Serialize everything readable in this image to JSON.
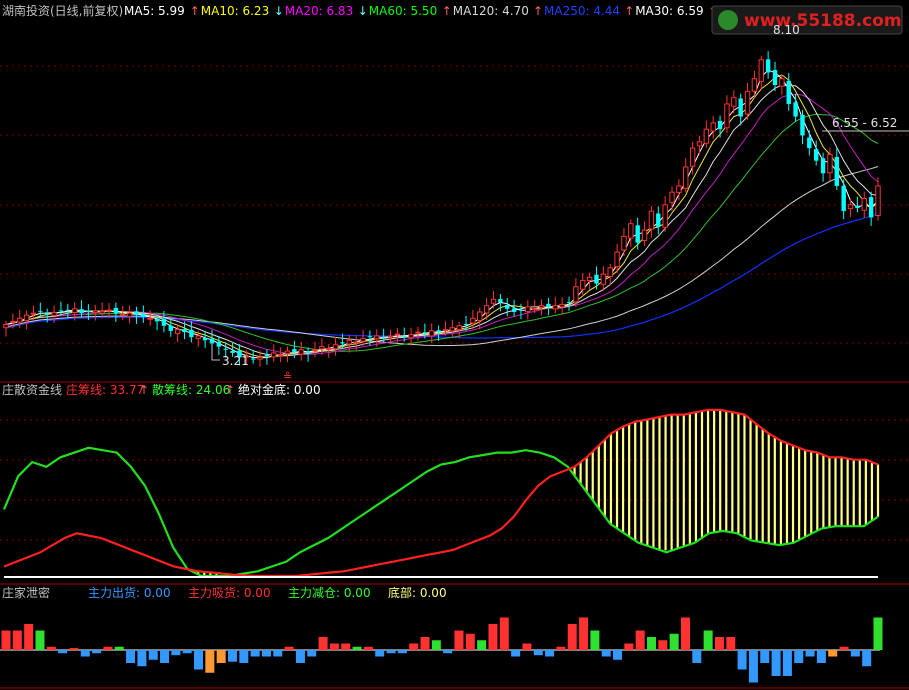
{
  "header": {
    "security_title": "湖南投资(日线,前复权)",
    "indicators": [
      {
        "label": "MA5: 5.99",
        "color": "#ffffff",
        "arrow": "up"
      },
      {
        "label": "MA10: 6.23",
        "color": "#ffff00",
        "arrow": "down"
      },
      {
        "label": "MA20: 6.83",
        "color": "#ff00ff",
        "arrow": "down"
      },
      {
        "label": "MA60: 5.50",
        "color": "#00ff00",
        "arrow": "up"
      },
      {
        "label": "MA120: 4.70",
        "color": "#d8d8d8",
        "arrow": "up"
      },
      {
        "label": "MA250: 4.44",
        "color": "#2040ff",
        "arrow": "up"
      },
      {
        "label": "MA30: 6.59",
        "color": "#ffffff",
        "arrow": "up"
      },
      {
        "label": "MA3: 6.00",
        "color": "#ffffff",
        "arrow": "up"
      }
    ]
  },
  "watermark": "www.55188.com",
  "price_panel": {
    "high_label": "8.10",
    "low_label": "3.21",
    "range_label": "6.55 - 6.52"
  },
  "fund_panel": {
    "title": "庄散资金线",
    "items": [
      {
        "label": "庄筹线: 33.77",
        "color": "#ff3030",
        "arrow": "up"
      },
      {
        "label": "散筹线: 24.06",
        "color": "#30ff30",
        "arrow": "up"
      },
      {
        "label": "绝对金底: 0.00",
        "color": "#ffffff",
        "arrow": ""
      }
    ]
  },
  "secret_panel": {
    "title": "庄家泄密",
    "items": [
      {
        "label": "主力出货: 0.00",
        "color": "#3399ff"
      },
      {
        "label": "主力吸货: 0.00",
        "color": "#ff3030"
      },
      {
        "label": "主力减仓: 0.00",
        "color": "#30ff30"
      },
      {
        "label": "底部: 0.00",
        "color": "#ffff80"
      }
    ]
  },
  "colors": {
    "up": "#ff3232",
    "down": "#00ffff",
    "grid": "#800000",
    "hatch": "#ffff80",
    "zhuang": "#ff2020",
    "san": "#20e020",
    "chu": "#3399ff",
    "jian": "#30e030",
    "di": "#ff9933"
  },
  "chart_data": {
    "type": "candlestick",
    "price_range": [
      3.0,
      8.6
    ],
    "close": [
      3.8,
      3.85,
      3.9,
      3.95,
      3.98,
      4.0,
      3.97,
      3.99,
      4.02,
      4.03,
      4.05,
      3.98,
      4.0,
      4.02,
      4.01,
      4.03,
      3.98,
      3.96,
      3.98,
      3.95,
      3.92,
      3.9,
      3.85,
      3.78,
      3.7,
      3.72,
      3.68,
      3.6,
      3.62,
      3.55,
      3.5,
      3.45,
      3.4,
      3.35,
      3.28,
      3.3,
      3.25,
      3.28,
      3.3,
      3.35,
      3.32,
      3.38,
      3.36,
      3.4,
      3.35,
      3.4,
      3.45,
      3.42,
      3.48,
      3.5,
      3.55,
      3.52,
      3.58,
      3.6,
      3.62,
      3.58,
      3.62,
      3.65,
      3.6,
      3.64,
      3.68,
      3.66,
      3.7,
      3.68,
      3.72,
      3.75,
      3.78,
      3.8,
      3.9,
      4.0,
      4.1,
      4.2,
      4.15,
      4.05,
      4.0,
      4.02,
      4.08,
      4.05,
      4.1,
      4.08,
      4.1,
      4.12,
      4.15,
      4.4,
      4.5,
      4.55,
      4.45,
      4.6,
      4.7,
      4.95,
      5.2,
      5.4,
      5.1,
      5.3,
      5.6,
      5.35,
      5.7,
      5.9,
      6.0,
      6.3,
      6.6,
      6.7,
      6.9,
      7.0,
      6.9,
      7.3,
      7.4,
      7.1,
      7.5,
      7.7,
      8.0,
      7.8,
      7.6,
      7.7,
      7.3,
      7.1,
      6.8,
      6.6,
      6.4,
      6.2,
      6.5,
      6.0,
      5.6,
      5.7,
      5.65,
      5.8,
      5.5,
      6.0
    ],
    "fund_zhuang": [
      4,
      6,
      8,
      10,
      13,
      16,
      18,
      17,
      16,
      14,
      12,
      10,
      8,
      6,
      4,
      3,
      2,
      1.5,
      1,
      0.5,
      0.2,
      0,
      0,
      0,
      0,
      0.5,
      1,
      1.5,
      2,
      3,
      4,
      5,
      6,
      7,
      8,
      9,
      10,
      11,
      13,
      15,
      17,
      20,
      25,
      32,
      38,
      42,
      44,
      46,
      50,
      55,
      60,
      63,
      65,
      66,
      67,
      68,
      68,
      69,
      70,
      70,
      69,
      68,
      64,
      60,
      57,
      55,
      53,
      52,
      50,
      50,
      49,
      49,
      47
    ],
    "fund_san": [
      28,
      42,
      48,
      46,
      50,
      52,
      54,
      53,
      52,
      46,
      38,
      26,
      12,
      3,
      0,
      0,
      0,
      1,
      2,
      4,
      6,
      10,
      13,
      16,
      20,
      24,
      28,
      32,
      36,
      40,
      44,
      47,
      48,
      50,
      51,
      52,
      52,
      53,
      52,
      50,
      46,
      38,
      30,
      22,
      18,
      14,
      12,
      10,
      12,
      14,
      18,
      19,
      18,
      15,
      14,
      13,
      14,
      17,
      20,
      21,
      21,
      21,
      25
    ],
    "secret_bars": [
      3,
      3,
      4,
      3,
      0.5,
      -0.5,
      0.3,
      -1,
      -0.5,
      0.5,
      0.5,
      -2,
      -2.5,
      -1.5,
      -2,
      -0.8,
      -0.5,
      -3,
      -3.5,
      -2,
      -1.8,
      -2,
      -1,
      -1,
      -1,
      0.5,
      -2,
      -1,
      2,
      1,
      1,
      0.5,
      0.5,
      -1,
      -0.5,
      -0.5,
      1,
      2,
      1.5,
      -0.5,
      3,
      2.5,
      1.5,
      4,
      5,
      -1,
      1,
      -0.8,
      -1,
      0.5,
      4,
      5,
      3,
      -1,
      -1.5,
      1,
      3,
      2,
      1.5,
      2.5,
      5,
      -2,
      3,
      2,
      2,
      -3,
      -5,
      -2,
      -4,
      -4,
      -2,
      -1,
      -2,
      -1,
      0.5,
      -1,
      -2.5,
      5
    ]
  }
}
